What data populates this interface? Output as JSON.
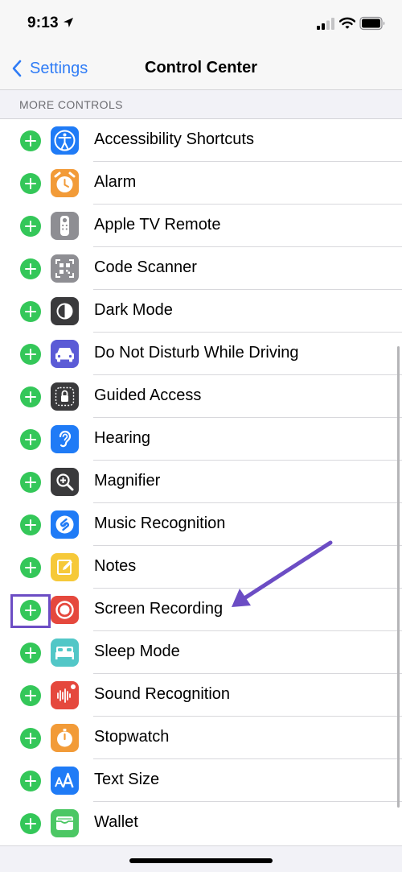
{
  "status": {
    "time": "9:13"
  },
  "nav": {
    "back_label": "Settings",
    "title": "Control Center"
  },
  "section": {
    "header": "MORE CONTROLS"
  },
  "rows": [
    {
      "label": "Accessibility Shortcuts",
      "icon": "accessibility-icon",
      "color": "#1f7bf6"
    },
    {
      "label": "Alarm",
      "icon": "alarm-clock-icon",
      "color": "#f29b38"
    },
    {
      "label": "Apple TV Remote",
      "icon": "tv-remote-icon",
      "color": "#8e8e93"
    },
    {
      "label": "Code Scanner",
      "icon": "qr-code-icon",
      "color": "#8e8e93"
    },
    {
      "label": "Dark Mode",
      "icon": "dark-mode-icon",
      "color": "#3a3a3c"
    },
    {
      "label": "Do Not Disturb While Driving",
      "icon": "car-icon",
      "color": "#5b5bd6"
    },
    {
      "label": "Guided Access",
      "icon": "lock-icon",
      "color": "#3a3a3c"
    },
    {
      "label": "Hearing",
      "icon": "ear-icon",
      "color": "#1f7bf6"
    },
    {
      "label": "Magnifier",
      "icon": "magnifier-icon",
      "color": "#3a3a3c"
    },
    {
      "label": "Music Recognition",
      "icon": "shazam-icon",
      "color": "#1f7bf6"
    },
    {
      "label": "Notes",
      "icon": "notes-icon",
      "color": "#f6c939"
    },
    {
      "label": "Screen Recording",
      "icon": "record-icon",
      "color": "#e5483d"
    },
    {
      "label": "Sleep Mode",
      "icon": "bed-icon",
      "color": "#52c7c7"
    },
    {
      "label": "Sound Recognition",
      "icon": "waveform-icon",
      "color": "#e5483d"
    },
    {
      "label": "Stopwatch",
      "icon": "stopwatch-icon",
      "color": "#f29b38"
    },
    {
      "label": "Text Size",
      "icon": "text-size-icon",
      "color": "#1f7bf6"
    },
    {
      "label": "Wallet",
      "icon": "wallet-icon",
      "color": "#4cc764"
    }
  ],
  "colors": {
    "accent": "#2f7cf6",
    "add_button": "#34c759",
    "annotation": "#6c4dc4",
    "bar_background": "#f7f7f7",
    "grouped_background": "#f2f2f7"
  }
}
